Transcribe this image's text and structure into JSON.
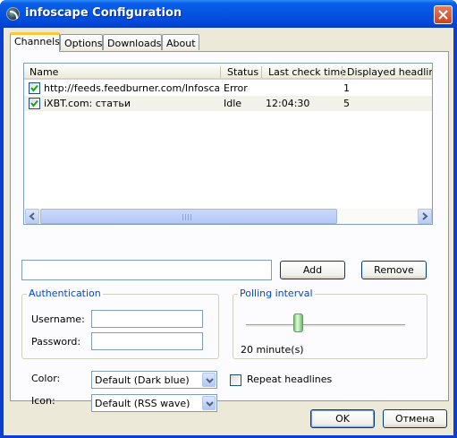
{
  "window": {
    "title": "infoscape Configuration"
  },
  "tabs": [
    {
      "label": "Channels",
      "active": true
    },
    {
      "label": "Options",
      "active": false
    },
    {
      "label": "Downloads",
      "active": false
    },
    {
      "label": "About",
      "active": false
    }
  ],
  "channels": {
    "columns": [
      "Name",
      "Status",
      "Last check time",
      "Displayed headlines"
    ],
    "rows": [
      {
        "checked": true,
        "name": "http://feeds.feedburner.com/Infoscape",
        "status": "Error",
        "last_check": "",
        "displayed": "1"
      },
      {
        "checked": true,
        "name": "iXBT.com: статьи",
        "status": "Idle",
        "last_check": "12:04:30",
        "displayed": "5"
      }
    ]
  },
  "url_input": {
    "value": ""
  },
  "buttons": {
    "add": "Add",
    "remove": "Remove",
    "ok": "OK",
    "cancel": "Отмена"
  },
  "authentication": {
    "title": "Authentication",
    "username_label": "Username:",
    "password_label": "Password:",
    "username": "",
    "password": ""
  },
  "polling": {
    "title": "Polling interval",
    "value_label": "20 minute(s)",
    "slider_fraction": 0.33
  },
  "color": {
    "label": "Color:",
    "selected": "Default (Dark blue)"
  },
  "icon": {
    "label": "Icon:",
    "selected": "Default (RSS wave)"
  },
  "repeat_headlines": {
    "label": "Repeat headlines",
    "checked": false
  },
  "colors": {
    "titlebar": "#0453e0",
    "dialog_bg": "#ece9d8",
    "active_tab_accent": "#ffc83c",
    "group_title": "#0046d5"
  }
}
